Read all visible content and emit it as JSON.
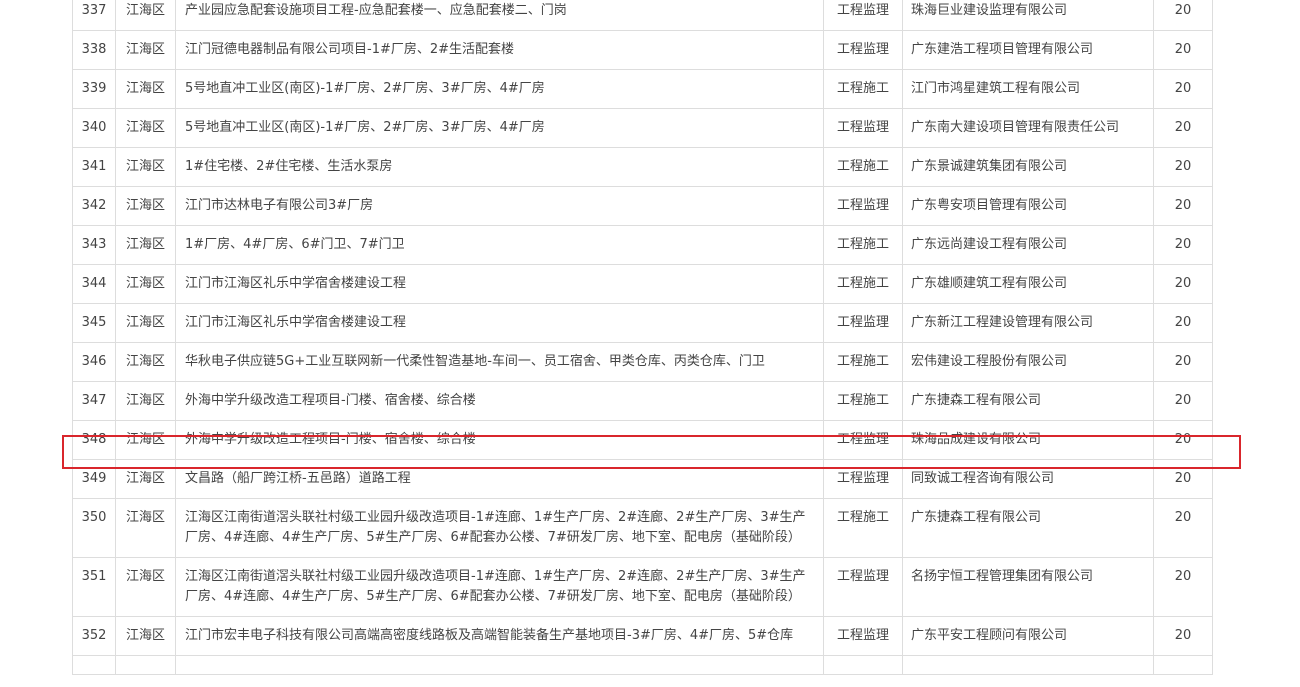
{
  "rows": [
    {
      "no": "337",
      "district": "江海区",
      "project": "产业园应急配套设施项目工程-应急配套楼一、应急配套楼二、门岗",
      "type": "工程监理",
      "unit": "珠海巨业建设监理有限公司",
      "score": "20"
    },
    {
      "no": "338",
      "district": "江海区",
      "project": "江门冠德电器制品有限公司项目-1#厂房、2#生活配套楼",
      "type": "工程监理",
      "unit": "广东建浩工程项目管理有限公司",
      "score": "20"
    },
    {
      "no": "339",
      "district": "江海区",
      "project": "5号地直冲工业区(南区)-1#厂房、2#厂房、3#厂房、4#厂房",
      "type": "工程施工",
      "unit": "江门市鸿星建筑工程有限公司",
      "score": "20"
    },
    {
      "no": "340",
      "district": "江海区",
      "project": "5号地直冲工业区(南区)-1#厂房、2#厂房、3#厂房、4#厂房",
      "type": "工程监理",
      "unit": "广东南大建设项目管理有限责任公司",
      "score": "20"
    },
    {
      "no": "341",
      "district": "江海区",
      "project": "1#住宅楼、2#住宅楼、生活水泵房",
      "type": "工程施工",
      "unit": "广东景诚建筑集团有限公司",
      "score": "20"
    },
    {
      "no": "342",
      "district": "江海区",
      "project": "江门市达林电子有限公司3#厂房",
      "type": "工程监理",
      "unit": "广东粤安项目管理有限公司",
      "score": "20"
    },
    {
      "no": "343",
      "district": "江海区",
      "project": "1#厂房、4#厂房、6#门卫、7#门卫",
      "type": "工程施工",
      "unit": "广东远尚建设工程有限公司",
      "score": "20"
    },
    {
      "no": "344",
      "district": "江海区",
      "project": "江门市江海区礼乐中学宿舍楼建设工程",
      "type": "工程施工",
      "unit": "广东雄顺建筑工程有限公司",
      "score": "20"
    },
    {
      "no": "345",
      "district": "江海区",
      "project": "江门市江海区礼乐中学宿舍楼建设工程",
      "type": "工程监理",
      "unit": "广东新江工程建设管理有限公司",
      "score": "20"
    },
    {
      "no": "346",
      "district": "江海区",
      "project": "华秋电子供应链5G+工业互联网新一代柔性智造基地-车间一、员工宿舍、甲类仓库、丙类仓库、门卫",
      "type": "工程施工",
      "unit": "宏伟建设工程股份有限公司",
      "score": "20"
    },
    {
      "no": "347",
      "district": "江海区",
      "project": "外海中学升级改造工程项目-门楼、宿舍楼、综合楼",
      "type": "工程施工",
      "unit": "广东捷森工程有限公司",
      "score": "20"
    },
    {
      "no": "348",
      "district": "江海区",
      "project": "外海中学升级改造工程项目-门楼、宿舍楼、综合楼",
      "type": "工程监理",
      "unit": "珠海品成建设有限公司",
      "score": "20"
    },
    {
      "no": "349",
      "district": "江海区",
      "project": "文昌路（船厂跨江桥-五邑路）道路工程",
      "type": "工程监理",
      "unit": "同致诚工程咨询有限公司",
      "score": "20"
    },
    {
      "no": "350",
      "district": "江海区",
      "project": "江海区江南街道滘头联社村级工业园升级改造项目-1#连廊、1#生产厂房、2#连廊、2#生产厂房、3#生产厂房、4#连廊、4#生产厂房、5#生产厂房、6#配套办公楼、7#研发厂房、地下室、配电房（基础阶段）",
      "type": "工程施工",
      "unit": "广东捷森工程有限公司",
      "score": "20"
    },
    {
      "no": "351",
      "district": "江海区",
      "project": "江海区江南街道滘头联社村级工业园升级改造项目-1#连廊、1#生产厂房、2#连廊、2#生产厂房、3#生产厂房、4#连廊、4#生产厂房、5#生产厂房、6#配套办公楼、7#研发厂房、地下室、配电房（基础阶段）",
      "type": "工程监理",
      "unit": "名扬宇恒工程管理集团有限公司",
      "score": "20"
    },
    {
      "no": "352",
      "district": "江海区",
      "project": "江门市宏丰电子科技有限公司高端高密度线路板及高端智能装备生产基地项目-3#厂房、4#厂房、5#仓库",
      "type": "工程监理",
      "unit": "广东平安工程顾问有限公司",
      "score": "20"
    },
    {
      "no": "",
      "district": "",
      "project": "",
      "type": "",
      "unit": "",
      "score": ""
    }
  ],
  "highlight_color": "#d9262c"
}
